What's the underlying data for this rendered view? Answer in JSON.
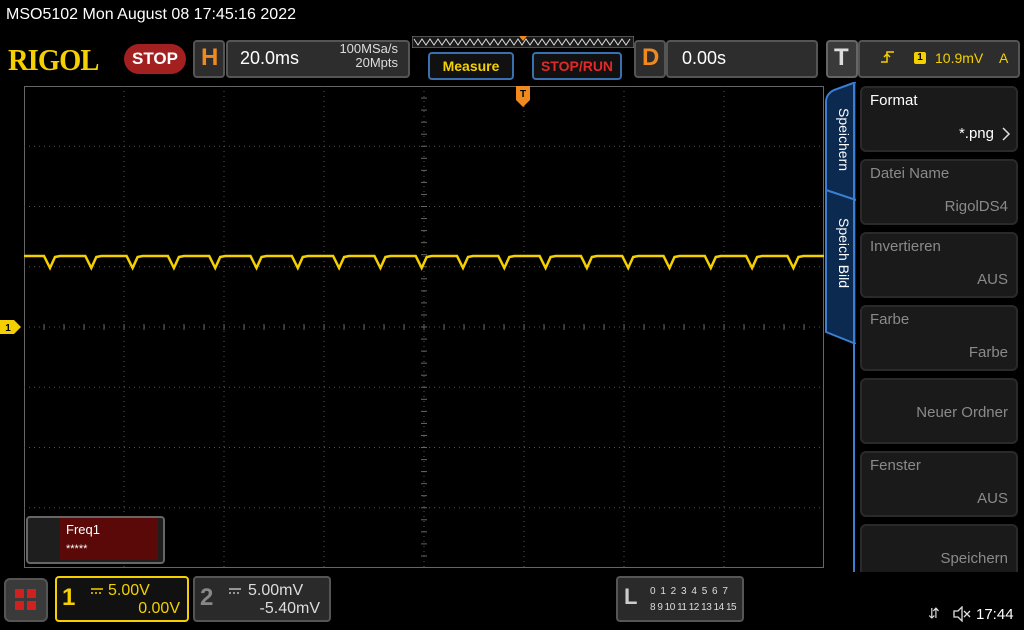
{
  "titlebar": {
    "text": "MSO5102  Mon August 08 17:45:16 2022"
  },
  "brand": {
    "logo": "RIGOL",
    "run_state": "STOP"
  },
  "horizontal": {
    "letter": "H",
    "timebase": "20.0ms",
    "sample_rate": "100MSa/s",
    "memory_depth": "20Mpts"
  },
  "buttons": {
    "measure": "Measure",
    "stop_run": "STOP/RUN"
  },
  "delay": {
    "letter": "D",
    "value": "0.00s"
  },
  "trigger": {
    "letter": "T",
    "channel": "1",
    "level": "10.9mV",
    "mode": "A",
    "edge_icon": "rising-edge-icon"
  },
  "waveform": {
    "channel": "1",
    "color": "#f5d000",
    "marker_label": "1",
    "trigger_marker": "T"
  },
  "measurement": {
    "label": "Freq1",
    "value": "*****"
  },
  "sidebar_tabs": {
    "save": "Speichern",
    "save_image": "Speich Bild"
  },
  "menu": [
    {
      "title": "Format",
      "value": "*.png",
      "has_arrow": true
    },
    {
      "title": "Datei Name",
      "value": "RigolDS4"
    },
    {
      "title": "Invertieren",
      "value": "AUS"
    },
    {
      "title": "Farbe",
      "value": "Farbe"
    },
    {
      "title": "",
      "value": "Neuer Ordner"
    },
    {
      "title": "Fenster",
      "value": "AUS"
    },
    {
      "title": "",
      "value": "Speichern"
    }
  ],
  "channels": {
    "ch1": {
      "num": "1",
      "coupling": "DC",
      "scale": "5.00V",
      "offset": "0.00V",
      "color": "#f5d000"
    },
    "ch2": {
      "num": "2",
      "coupling": "DC",
      "scale": "5.00mV",
      "offset": "-5.40mV"
    }
  },
  "logic_analyzer": {
    "letter": "L",
    "row1": "0 1 2 3  4 5 6 7",
    "row2": "8 9 10 11 12 13 14 15"
  },
  "status": {
    "time": "17:44"
  }
}
